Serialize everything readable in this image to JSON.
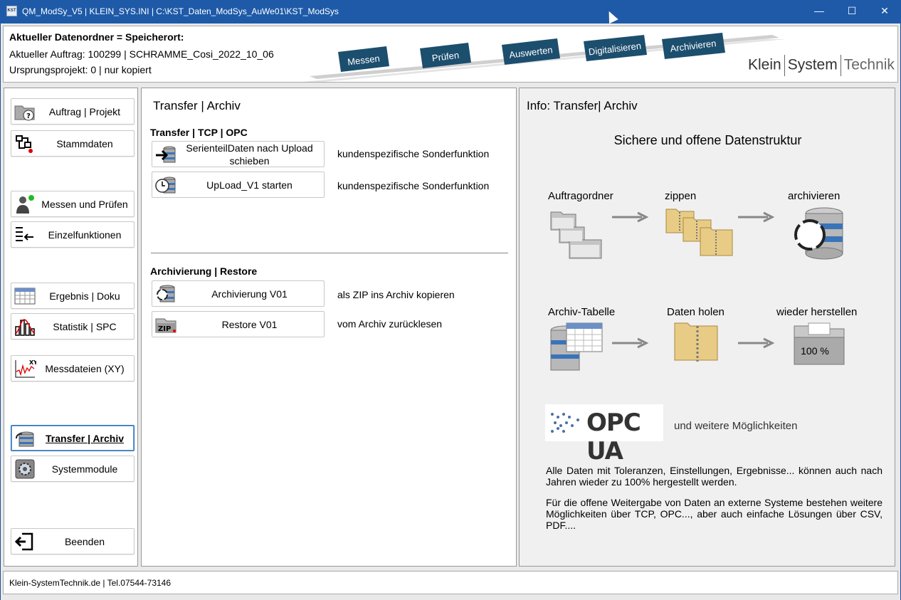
{
  "window": {
    "title": "QM_ModSy_V5  |  KLEIN_SYS.INI  |  C:\\KST_Daten_ModSys_AuWe01\\KST_ModSys",
    "app_icon": "KST",
    "controls": [
      "minimize-icon",
      "maximize-icon",
      "close-icon"
    ]
  },
  "header": {
    "line1": "Aktueller Datenordner = Speicherort:",
    "line2": "Aktueller Auftrag: 100299 | SCHRAMME_Cosi_2022_10_06",
    "line3": "Ursprungsprojekt: 0 | nur kopiert",
    "banner_steps": [
      "Messen",
      "Prüfen",
      "Auswerten",
      "Digitalisieren",
      "Archivieren"
    ],
    "brand": {
      "part1": "Klein",
      "part2": "System",
      "part3": "Technik"
    }
  },
  "nav": {
    "items": [
      {
        "label": "Auftrag | Projekt",
        "icon": "folder-question-icon"
      },
      {
        "label": "Stammdaten",
        "icon": "structure-icon"
      },
      {
        "label": "Messen und Prüfen",
        "icon": "operator-icon"
      },
      {
        "label": "Einzelfunktionen",
        "icon": "list-arrow-icon"
      },
      {
        "label": "Ergebnis | Doku",
        "icon": "table-icon"
      },
      {
        "label": "Statistik | SPC",
        "icon": "histogram-icon"
      },
      {
        "label": "Messdateien (XY)",
        "icon": "xy-chart-icon"
      },
      {
        "label": "Transfer | Archiv",
        "icon": "database-transfer-icon",
        "active": true
      },
      {
        "label": "Systemmodule",
        "icon": "gear-icon"
      },
      {
        "label": "Beenden",
        "icon": "exit-icon"
      }
    ]
  },
  "main": {
    "title": "Transfer | Archiv",
    "section1": {
      "title": "Transfer | TCP | OPC",
      "actions": [
        {
          "label": "SerienteilDaten nach Upload schieben",
          "desc": "kundenspezifische Sonderfunktion",
          "icon": "upload-arrow-icon"
        },
        {
          "label": "UpLoad_V1 starten",
          "desc": "kundenspezifische Sonderfunktion",
          "icon": "clock-database-icon"
        }
      ]
    },
    "section2": {
      "title": "Archivierung | Restore",
      "actions": [
        {
          "label": "Archivierung V01",
          "desc": "als ZIP ins Archiv kopieren",
          "icon": "archive-database-icon"
        },
        {
          "label": "Restore V01",
          "desc": "vom Archiv zurücklesen",
          "icon": "zip-icon"
        }
      ]
    }
  },
  "info": {
    "title": "Info: Transfer| Archiv",
    "heading": "Sichere und offene Datenstruktur",
    "row1": [
      "Auftragordner",
      "zippen",
      "archivieren"
    ],
    "row2": [
      "Archiv-Tabelle",
      "Daten holen",
      "wieder herstellen"
    ],
    "restore_percent": "100 %",
    "opc_logo": "OPC UA",
    "more": "und weitere Möglichkeiten",
    "para1": "Alle Daten mit Toleranzen, Einstellungen, Ergebnisse... können auch nach Jahren wieder zu 100% hergestellt werden.",
    "para2": "Für die offene Weitergabe von Daten an externe Systeme bestehen weitere Möglichkeiten über TCP, OPC..., aber auch einfache Lösungen über CSV, PDF...."
  },
  "status": {
    "text": "Klein-SystemTechnik.de  |  Tel.07544-73146"
  },
  "colors": {
    "titlebar": "#1e5aa8",
    "banner_step": "#1c4e6e",
    "active_border": "#2a6fb5"
  }
}
